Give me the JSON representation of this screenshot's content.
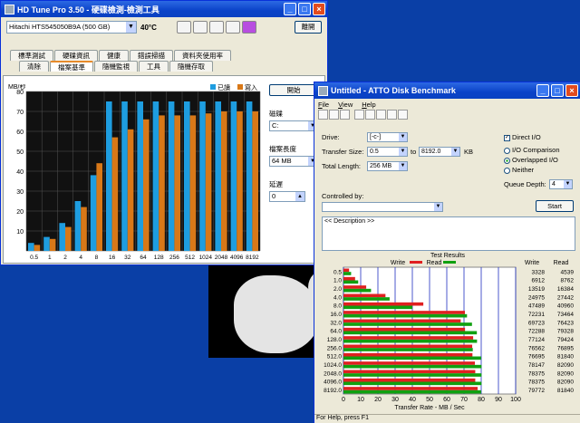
{
  "hdtune": {
    "title": "HD Tune Pro 3.50 - 硬碟檢測-檢測工具",
    "drive": "Hitachi HTS545050B9A (500 GB)",
    "temp": "40°C",
    "exit": "離開",
    "tabs_row1": [
      "標準測試",
      "硬碟資訊",
      "健康",
      "錯誤掃描",
      "資料夾使用率"
    ],
    "tabs_row2": [
      "清除",
      "檔案基準",
      "隨機監視",
      "工具",
      "隨機存取"
    ],
    "start": "開始",
    "drive_label": "磁碟",
    "drive_value": "C:",
    "filesize_label": "檔案長度",
    "filesize_value": "64 MB",
    "delay_label": "延遲",
    "delay_value": "0"
  },
  "hd_chart": {
    "unit": "MB/秒",
    "legend_read": "已讀",
    "legend_write": "寫入",
    "ylabels": [
      "80",
      "70",
      "60",
      "50",
      "40",
      "30",
      "20",
      "10"
    ]
  },
  "chart_data": [
    {
      "type": "bar",
      "title": "",
      "ylabel": "MB/秒",
      "ylim": [
        0,
        80
      ],
      "categories": [
        "0.5",
        "1",
        "2",
        "4",
        "8",
        "16",
        "32",
        "64",
        "128",
        "256",
        "512",
        "1024",
        "2048",
        "4096",
        "8192"
      ],
      "series": [
        {
          "name": "已讀",
          "values": [
            4,
            7,
            14,
            25,
            38,
            75,
            75,
            75,
            75,
            75,
            75,
            75,
            75,
            75,
            75
          ]
        },
        {
          "name": "寫入",
          "values": [
            3,
            6,
            12,
            22,
            44,
            57,
            61,
            66,
            68,
            68,
            68,
            69,
            70,
            70,
            70
          ]
        }
      ],
      "colors": {
        "read": "#1e9de0",
        "write": "#d87818"
      }
    },
    {
      "type": "bar",
      "title": "Test Results",
      "xlabel": "Transfer Rate - MB / Sec",
      "xlim": [
        0,
        100
      ],
      "categories": [
        "0.5",
        "1.0",
        "2.0",
        "4.0",
        "8.0",
        "16.0",
        "32.0",
        "64.0",
        "128.0",
        "256.0",
        "512.0",
        "1024.0",
        "2048.0",
        "4096.0",
        "8192.0"
      ],
      "series": [
        {
          "name": "Write",
          "values": [
            3328,
            6912,
            13519,
            24975,
            47489,
            72231,
            69723,
            72288,
            77124,
            76562,
            76695,
            78147,
            78375,
            78375,
            79772
          ]
        },
        {
          "name": "Read",
          "values": [
            4539,
            8762,
            16384,
            27442,
            40960,
            73464,
            76423,
            79328,
            79424,
            76895,
            81840,
            82090,
            82090,
            82090,
            81840
          ]
        }
      ],
      "colors": {
        "write": "#e02020",
        "read": "#10a010"
      }
    }
  ],
  "atto": {
    "title": "Untitled - ATTO Disk Benchmark",
    "menu": [
      "File",
      "View",
      "Help"
    ],
    "drive_label": "Drive:",
    "drive_value": "[-c-]",
    "tsize_label": "Transfer Size:",
    "tsize_from": "0.5",
    "to_label": "to",
    "tsize_to": "8192.0",
    "kb": "KB",
    "tlen_label": "Total Length:",
    "tlen_value": "256 MB",
    "direct_io": "Direct I/O",
    "io_comp": "I/O Comparison",
    "overlapped": "Overlapped I/O",
    "neither": "Neither",
    "queue_label": "Queue Depth:",
    "queue_value": "4",
    "controlled_label": "Controlled by:",
    "start": "Start",
    "description": "<< Description >>",
    "results_title": "Test Results",
    "legend_write": "Write",
    "legend_read": "Read",
    "col_write": "Write",
    "col_read": "Read",
    "xlabel": "Transfer Rate - MB / Sec",
    "xticks": [
      "0",
      "10",
      "20",
      "30",
      "40",
      "50",
      "60",
      "70",
      "80",
      "90",
      "100"
    ],
    "status": "For Help, press F1"
  }
}
